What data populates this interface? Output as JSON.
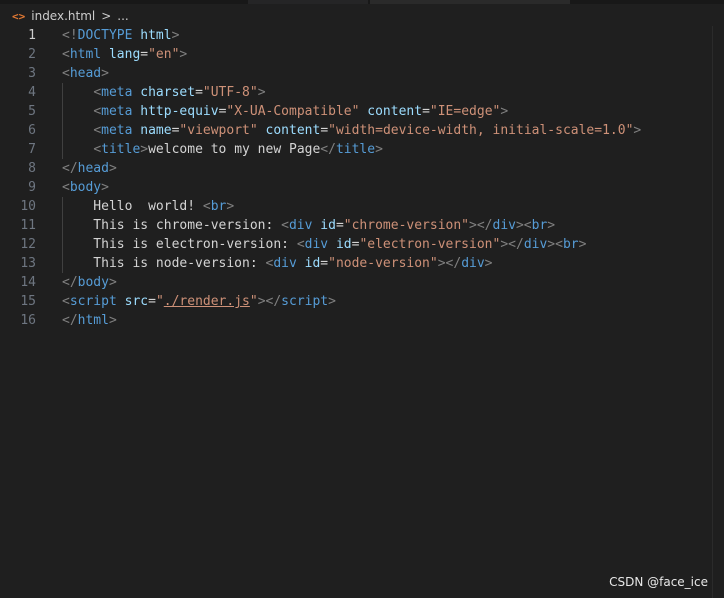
{
  "breadcrumb": {
    "file_icon": "<>",
    "file_name": "index.html",
    "separator": ">",
    "ellipsis": "..."
  },
  "lines": [
    {
      "num": "1",
      "tokens": [
        [
          "tag-b",
          "<!"
        ],
        [
          "tag",
          "DOCTYPE"
        ],
        [
          "txt",
          " "
        ],
        [
          "attr",
          "html"
        ],
        [
          "tag-b",
          ">"
        ]
      ]
    },
    {
      "num": "2",
      "tokens": [
        [
          "tag-b",
          "<"
        ],
        [
          "tag",
          "html"
        ],
        [
          "txt",
          " "
        ],
        [
          "attr",
          "lang"
        ],
        [
          "txt",
          "="
        ],
        [
          "str",
          "\"en\""
        ],
        [
          "tag-b",
          ">"
        ]
      ]
    },
    {
      "num": "3",
      "tokens": [
        [
          "tag-b",
          "<"
        ],
        [
          "tag",
          "head"
        ],
        [
          "tag-b",
          ">"
        ]
      ]
    },
    {
      "num": "4",
      "tokens": [
        [
          "txt",
          "    "
        ],
        [
          "tag-b",
          "<"
        ],
        [
          "tag",
          "meta"
        ],
        [
          "txt",
          " "
        ],
        [
          "attr",
          "charset"
        ],
        [
          "txt",
          "="
        ],
        [
          "str",
          "\"UTF-8\""
        ],
        [
          "tag-b",
          ">"
        ]
      ]
    },
    {
      "num": "5",
      "tokens": [
        [
          "txt",
          "    "
        ],
        [
          "tag-b",
          "<"
        ],
        [
          "tag",
          "meta"
        ],
        [
          "txt",
          " "
        ],
        [
          "attr",
          "http-equiv"
        ],
        [
          "txt",
          "="
        ],
        [
          "str",
          "\"X-UA-Compatible\""
        ],
        [
          "txt",
          " "
        ],
        [
          "attr",
          "content"
        ],
        [
          "txt",
          "="
        ],
        [
          "str",
          "\"IE=edge\""
        ],
        [
          "tag-b",
          ">"
        ]
      ]
    },
    {
      "num": "6",
      "tokens": [
        [
          "txt",
          "    "
        ],
        [
          "tag-b",
          "<"
        ],
        [
          "tag",
          "meta"
        ],
        [
          "txt",
          " "
        ],
        [
          "attr",
          "name"
        ],
        [
          "txt",
          "="
        ],
        [
          "str",
          "\"viewport\""
        ],
        [
          "txt",
          " "
        ],
        [
          "attr",
          "content"
        ],
        [
          "txt",
          "="
        ],
        [
          "str",
          "\"width=device-width, initial-scale=1.0\""
        ],
        [
          "tag-b",
          ">"
        ]
      ]
    },
    {
      "num": "7",
      "tokens": [
        [
          "txt",
          "    "
        ],
        [
          "tag-b",
          "<"
        ],
        [
          "tag",
          "title"
        ],
        [
          "tag-b",
          ">"
        ],
        [
          "txt",
          "welcome to my new Page"
        ],
        [
          "tag-b",
          "</"
        ],
        [
          "tag",
          "title"
        ],
        [
          "tag-b",
          ">"
        ]
      ]
    },
    {
      "num": "8",
      "tokens": [
        [
          "tag-b",
          "</"
        ],
        [
          "tag",
          "head"
        ],
        [
          "tag-b",
          ">"
        ]
      ]
    },
    {
      "num": "9",
      "tokens": [
        [
          "tag-b",
          "<"
        ],
        [
          "tag",
          "body"
        ],
        [
          "tag-b",
          ">"
        ]
      ]
    },
    {
      "num": "10",
      "tokens": [
        [
          "txt",
          "    Hello  world! "
        ],
        [
          "tag-b",
          "<"
        ],
        [
          "tag",
          "br"
        ],
        [
          "tag-b",
          ">"
        ]
      ]
    },
    {
      "num": "11",
      "tokens": [
        [
          "txt",
          "    This is chrome-version: "
        ],
        [
          "tag-b",
          "<"
        ],
        [
          "tag",
          "div"
        ],
        [
          "txt",
          " "
        ],
        [
          "attr",
          "id"
        ],
        [
          "txt",
          "="
        ],
        [
          "str",
          "\"chrome-version\""
        ],
        [
          "tag-b",
          "></"
        ],
        [
          "tag",
          "div"
        ],
        [
          "tag-b",
          "><"
        ],
        [
          "tag",
          "br"
        ],
        [
          "tag-b",
          ">"
        ]
      ]
    },
    {
      "num": "12",
      "tokens": [
        [
          "txt",
          "    This is electron-version: "
        ],
        [
          "tag-b",
          "<"
        ],
        [
          "tag",
          "div"
        ],
        [
          "txt",
          " "
        ],
        [
          "attr",
          "id"
        ],
        [
          "txt",
          "="
        ],
        [
          "str",
          "\"electron-version\""
        ],
        [
          "tag-b",
          "></"
        ],
        [
          "tag",
          "div"
        ],
        [
          "tag-b",
          "><"
        ],
        [
          "tag",
          "br"
        ],
        [
          "tag-b",
          ">"
        ]
      ]
    },
    {
      "num": "13",
      "tokens": [
        [
          "txt",
          "    This is node-version: "
        ],
        [
          "tag-b",
          "<"
        ],
        [
          "tag",
          "div"
        ],
        [
          "txt",
          " "
        ],
        [
          "attr",
          "id"
        ],
        [
          "txt",
          "="
        ],
        [
          "str",
          "\"node-version\""
        ],
        [
          "tag-b",
          "></"
        ],
        [
          "tag",
          "div"
        ],
        [
          "tag-b",
          ">"
        ]
      ]
    },
    {
      "num": "14",
      "tokens": [
        [
          "tag-b",
          "</"
        ],
        [
          "tag",
          "body"
        ],
        [
          "tag-b",
          ">"
        ]
      ]
    },
    {
      "num": "15",
      "tokens": [
        [
          "tag-b",
          "<"
        ],
        [
          "tag",
          "script"
        ],
        [
          "txt",
          " "
        ],
        [
          "attr",
          "src"
        ],
        [
          "txt",
          "="
        ],
        [
          "str",
          "\""
        ],
        [
          "str link",
          "./render.js"
        ],
        [
          "str",
          "\""
        ],
        [
          "tag-b",
          "></"
        ],
        [
          "tag",
          "script"
        ],
        [
          "tag-b",
          ">"
        ]
      ]
    },
    {
      "num": "16",
      "tokens": [
        [
          "tag-b",
          "</"
        ],
        [
          "tag",
          "html"
        ],
        [
          "tag-b",
          ">"
        ]
      ]
    }
  ],
  "active_line": "1",
  "watermark": "CSDN @face_ice"
}
